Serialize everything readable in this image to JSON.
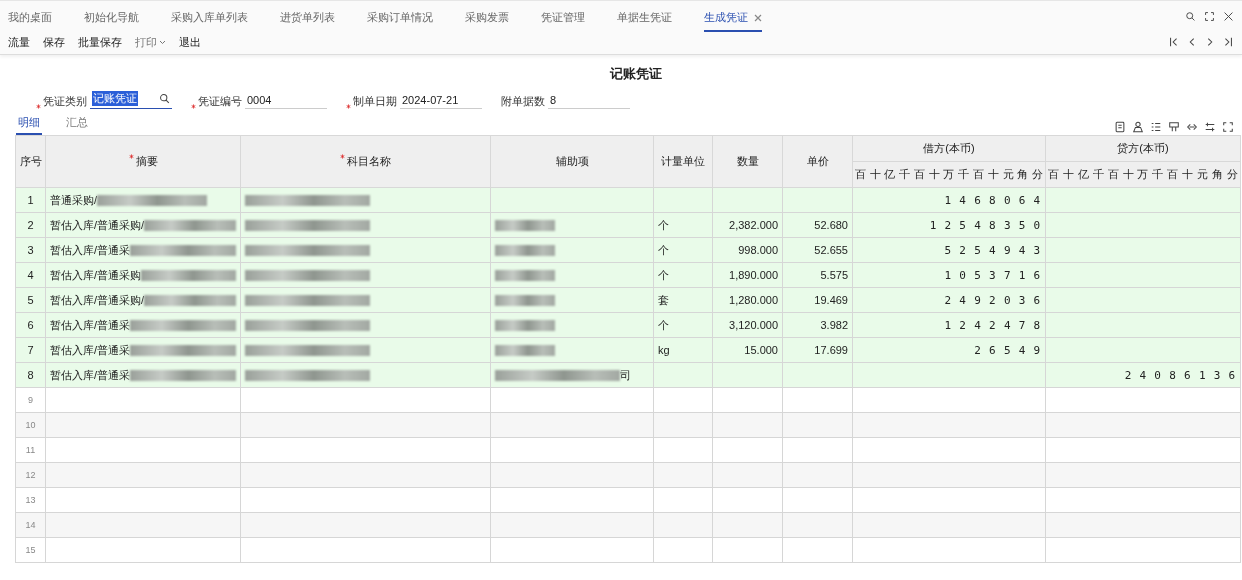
{
  "tabs": [
    {
      "label": "我的桌面",
      "selected": false,
      "closable": false
    },
    {
      "label": "初始化导航",
      "selected": false,
      "closable": false
    },
    {
      "label": "采购入库单列表",
      "selected": false,
      "closable": false
    },
    {
      "label": "进货单列表",
      "selected": false,
      "closable": false
    },
    {
      "label": "采购订单情况",
      "selected": false,
      "closable": false
    },
    {
      "label": "采购发票",
      "selected": false,
      "closable": false
    },
    {
      "label": "凭证管理",
      "selected": false,
      "closable": false
    },
    {
      "label": "单据生凭证",
      "selected": false,
      "closable": false
    },
    {
      "label": "生成凭证",
      "selected": true,
      "closable": true
    }
  ],
  "toolbar": [
    {
      "label": "流量",
      "kind": "button"
    },
    {
      "label": "保存",
      "kind": "button"
    },
    {
      "label": "批量保存",
      "kind": "button"
    },
    {
      "label": "打印",
      "kind": "menu"
    },
    {
      "label": "退出",
      "kind": "button"
    }
  ],
  "title": "记账凭证",
  "form": [
    {
      "label": "凭证类别",
      "required": true,
      "value": "记账凭证",
      "highlighted": true,
      "kind": "lookup"
    },
    {
      "label": "凭证编号",
      "required": true,
      "value": "0004",
      "highlighted": false,
      "kind": "text"
    },
    {
      "label": "制单日期",
      "required": true,
      "value": "2024-07-21",
      "highlighted": false,
      "kind": "text"
    },
    {
      "label": "附单据数",
      "required": false,
      "value": "8",
      "highlighted": false,
      "kind": "text"
    }
  ],
  "subtabs": [
    {
      "label": "明细",
      "selected": true
    },
    {
      "label": "汇总",
      "selected": false
    }
  ],
  "table": {
    "columns": [
      {
        "label": "序号",
        "required": false
      },
      {
        "label": "摘要",
        "required": true
      },
      {
        "label": "科目名称",
        "required": true
      },
      {
        "label": "辅助项",
        "required": false
      },
      {
        "label": "计量单位",
        "required": false
      },
      {
        "label": "数量",
        "required": false
      },
      {
        "label": "单价",
        "required": false
      }
    ],
    "debit": {
      "label": "借方(本币)",
      "units": [
        "百",
        "十",
        "亿",
        "千",
        "百",
        "十",
        "万",
        "千",
        "百",
        "十",
        "元",
        "角",
        "分"
      ]
    },
    "credit": {
      "label": "贷方(本币)",
      "units": [
        "百",
        "十",
        "亿",
        "千",
        "百",
        "十",
        "万",
        "千",
        "百",
        "十",
        "元",
        "角",
        "分"
      ]
    },
    "rows": [
      {
        "no": "1",
        "summary": "普通采购/",
        "summary_blurred": true,
        "account_blurred": true,
        "aux_blurred": false,
        "debit": "1 4 6 8 0 6 4"
      },
      {
        "no": "2",
        "summary": "暂估入库/普通采购/",
        "summary_blurred": true,
        "account_blurred": true,
        "aux_blurred": true,
        "unit": "个",
        "qty": "2,382.000",
        "price": "52.680",
        "debit": "1 2 5 4 8 3 5 0"
      },
      {
        "no": "3",
        "summary": "暂估入库/普通采",
        "summary_blurred": true,
        "account_blurred": true,
        "aux_blurred": true,
        "unit": "个",
        "qty": "998.000",
        "price": "52.655",
        "debit": "5 2 5 4 9 4 3"
      },
      {
        "no": "4",
        "summary": "暂估入库/普通采购",
        "summary_blurred": true,
        "account_blurred": true,
        "aux_blurred": true,
        "unit": "个",
        "qty": "1,890.000",
        "price": "5.575",
        "debit": "1 0 5 3 7 1 6"
      },
      {
        "no": "5",
        "summary": "暂估入库/普通采购/",
        "summary_blurred": true,
        "account_blurred": true,
        "aux_blurred": true,
        "unit": "套",
        "qty": "1,280.000",
        "price": "19.469",
        "debit": "2 4 9 2 0 3 6"
      },
      {
        "no": "6",
        "summary": "暂估入库/普通采",
        "summary_blurred": true,
        "account_blurred": true,
        "aux_blurred": true,
        "unit": "个",
        "qty": "3,120.000",
        "price": "3.982",
        "debit": "1 2 4 2 4 7 8"
      },
      {
        "no": "7",
        "summary": "暂估入库/普通采",
        "summary_blurred": true,
        "account_blurred": true,
        "aux_blurred": true,
        "unit": "kg",
        "qty": "15.000",
        "price": "17.699",
        "debit": "2 6 5 4 9"
      },
      {
        "no": "8",
        "summary": "暂估入库/普通采",
        "summary_blurred": true,
        "account_blurred": true,
        "aux_blurred": true,
        "aux": "司",
        "credit": "2 4 0 8 6 1 3 6"
      }
    ],
    "empty_rows": [
      "9",
      "10",
      "11",
      "12",
      "13",
      "14",
      "15"
    ]
  }
}
